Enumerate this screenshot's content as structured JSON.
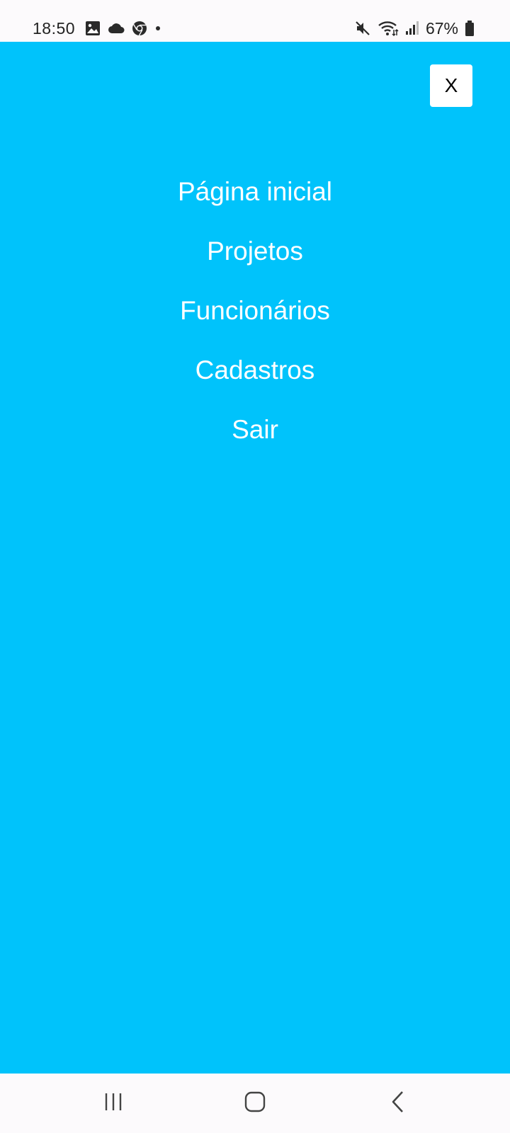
{
  "status_bar": {
    "time": "18:50",
    "battery_percent": "67%",
    "icons_left": [
      "gallery-icon",
      "cloud-icon",
      "chrome-icon",
      "notification-dot-icon"
    ],
    "icons_right": [
      "mute-icon",
      "wifi-icon",
      "signal-icon",
      "battery-icon"
    ]
  },
  "menu": {
    "background_color": "#00c3fb",
    "close_label": "X",
    "items": [
      {
        "label": "Página inicial"
      },
      {
        "label": "Projetos"
      },
      {
        "label": "Funcionários"
      },
      {
        "label": "Cadastros"
      },
      {
        "label": "Sair"
      }
    ]
  },
  "nav_bar": {
    "buttons": [
      "recent-apps-icon",
      "home-icon",
      "back-icon"
    ]
  }
}
